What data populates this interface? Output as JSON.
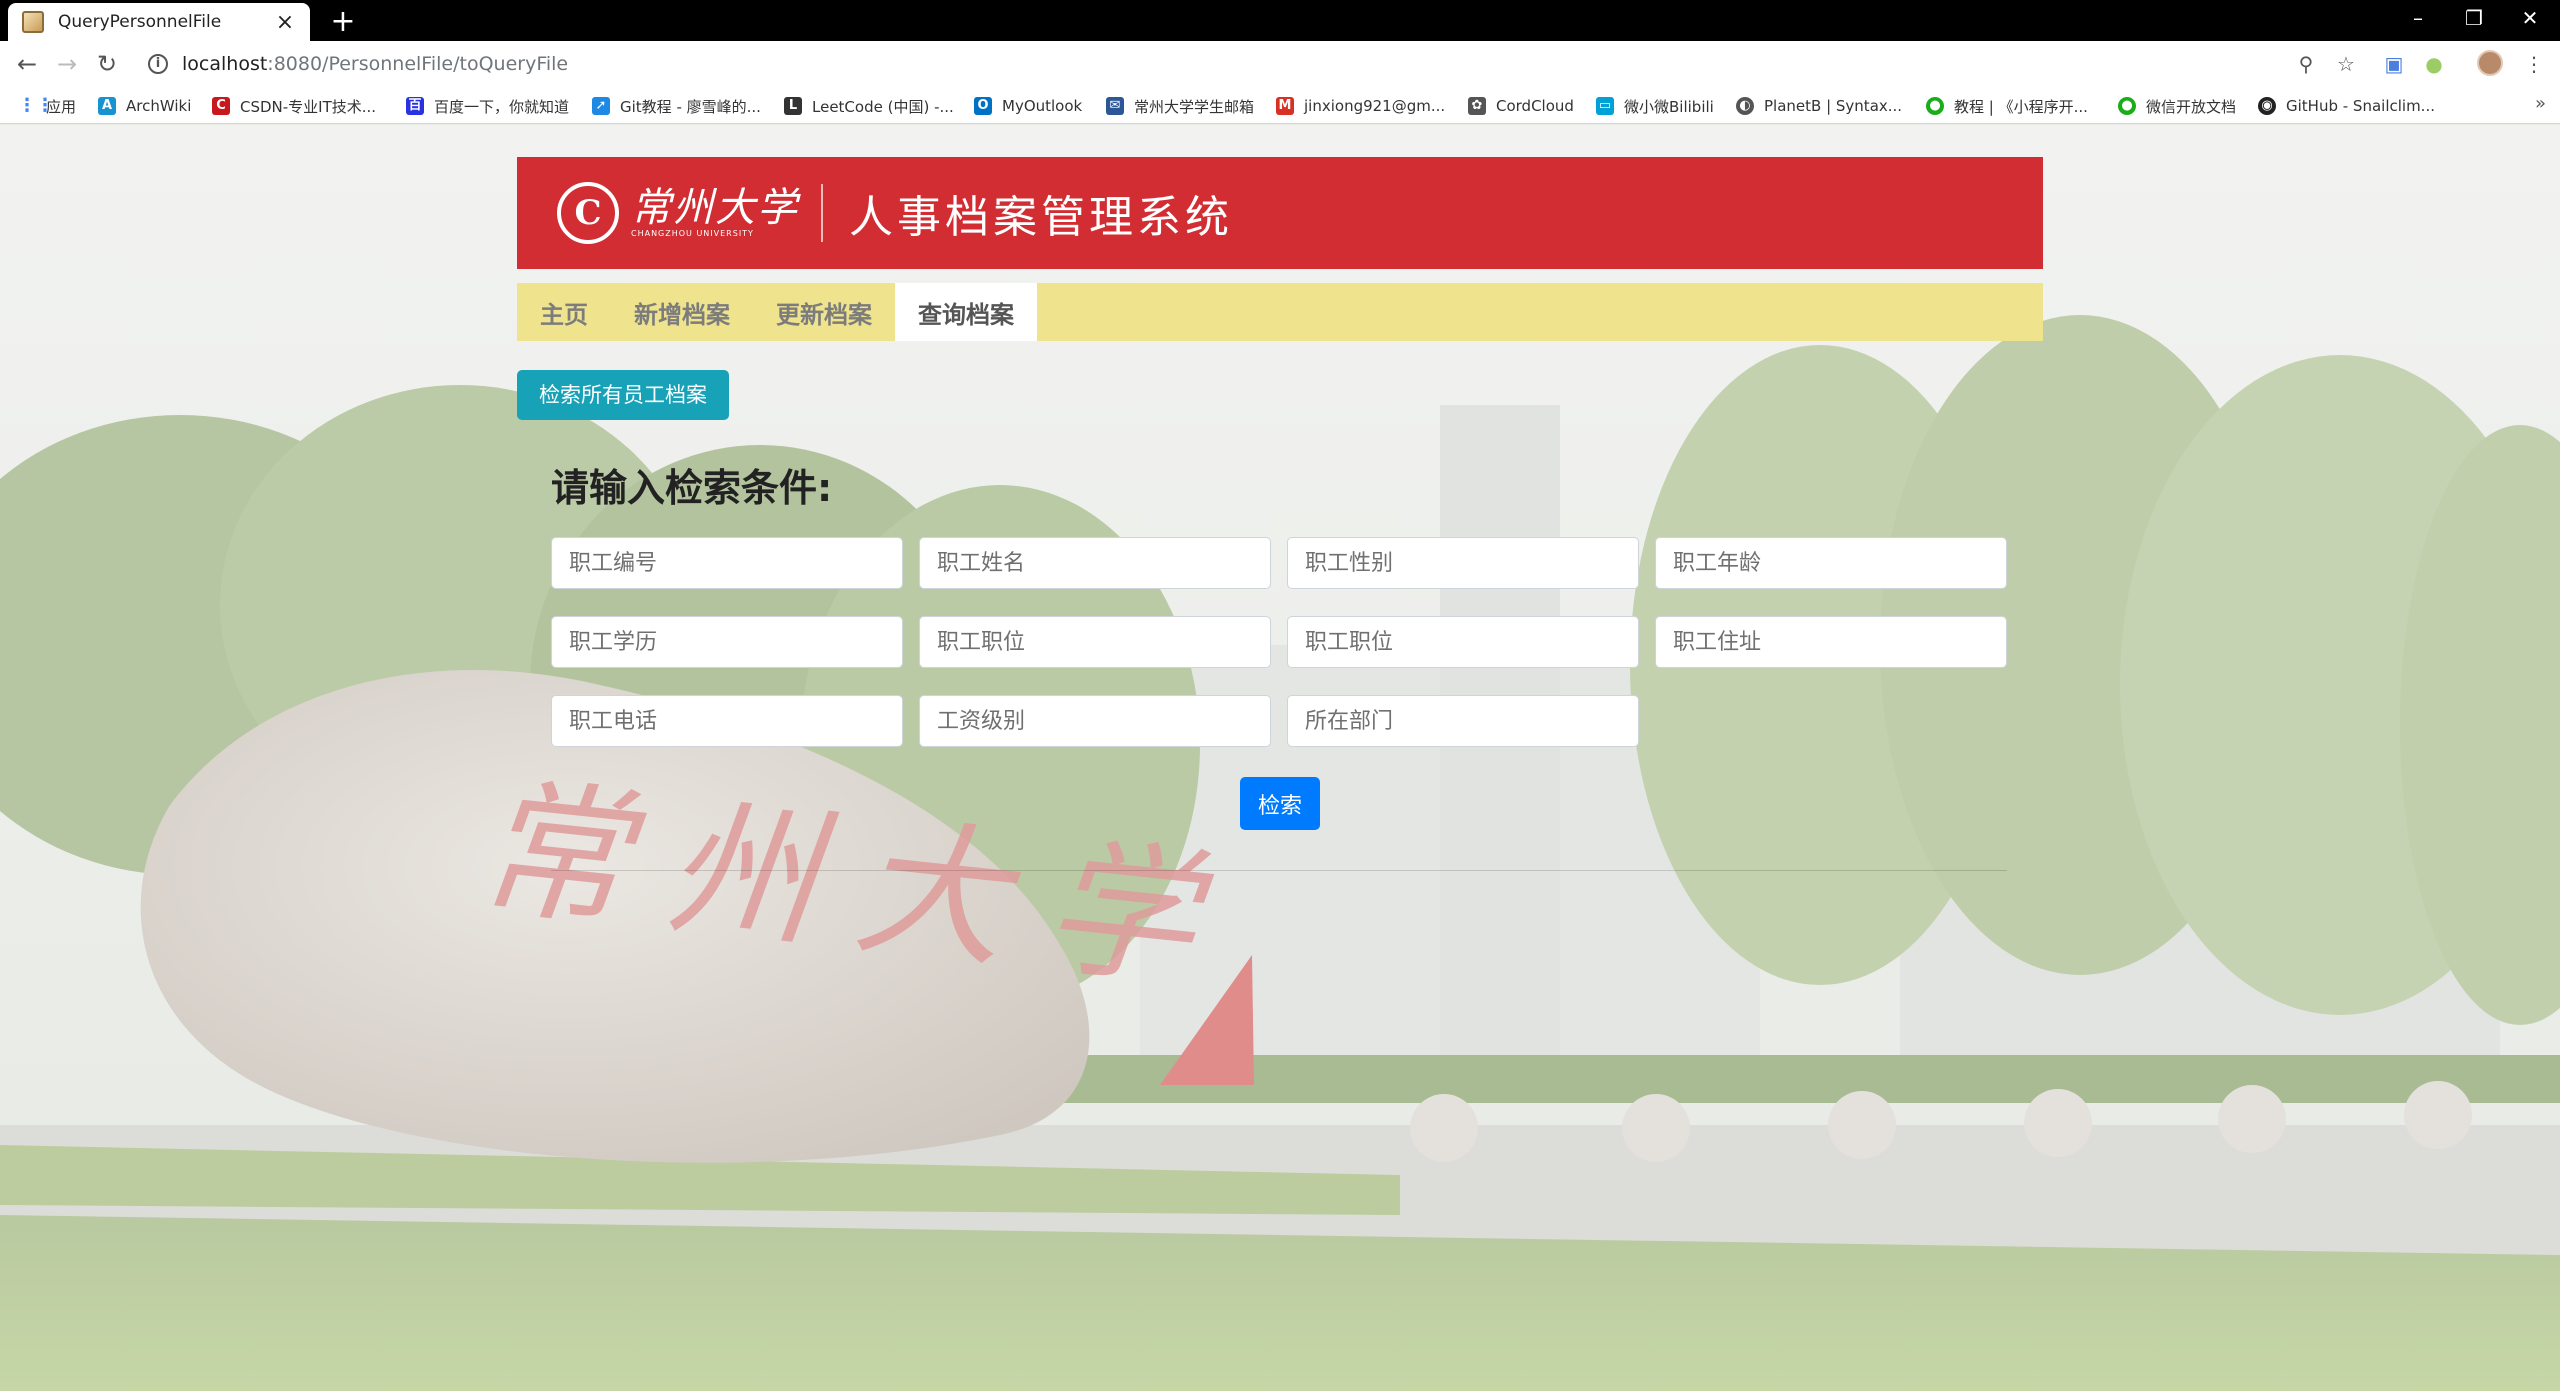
{
  "browser": {
    "tab_title": "QueryPersonnelFile",
    "new_tab": "+",
    "url_host": "localhost",
    "url_path": ":8080/PersonnelFile/toQueryFile",
    "bookmarks": [
      {
        "label": "应用",
        "color": "#4285f4"
      },
      {
        "label": "ArchWiki",
        "color": "#1793d1"
      },
      {
        "label": "CSDN-专业IT技术...",
        "color": "#c9171e"
      },
      {
        "label": "百度一下，你就知道",
        "color": "#2932e1"
      },
      {
        "label": "Git教程 - 廖雪峰的...",
        "color": "#1e88e5"
      },
      {
        "label": "LeetCode (中国) -...",
        "color": "#333333"
      },
      {
        "label": "MyOutlook",
        "color": "#0072c6"
      },
      {
        "label": "常州大学学生邮箱",
        "color": "#2b5797"
      },
      {
        "label": "jinxiong921@gm...",
        "color": "#d93025"
      },
      {
        "label": "CordCloud",
        "color": "#555555"
      },
      {
        "label": "微小微Bilibili",
        "color": "#00a1d6"
      },
      {
        "label": "PlanetB | Syntax...",
        "color": "#555555"
      },
      {
        "label": "教程 | 《小程序开...",
        "color": "#1aad19"
      },
      {
        "label": "微信开放文档",
        "color": "#1aad19"
      },
      {
        "label": "GitHub - Snailclim...",
        "color": "#222222"
      }
    ],
    "more_bookmarks": "»"
  },
  "header": {
    "logo_cn": "常州大学",
    "logo_en": "CHANGZHOU UNIVERSITY",
    "system_title": "人事档案管理系统"
  },
  "nav": {
    "items": [
      {
        "label": "主页"
      },
      {
        "label": "新增档案"
      },
      {
        "label": "更新档案"
      },
      {
        "label": "查询档案",
        "active": true
      }
    ]
  },
  "actions": {
    "query_all_label": "检索所有员工档案",
    "search_label": "检索"
  },
  "form": {
    "title": "请输入检索条件:",
    "fields": [
      {
        "placeholder": "职工编号",
        "value": ""
      },
      {
        "placeholder": "职工姓名",
        "value": ""
      },
      {
        "placeholder": "职工性别",
        "value": ""
      },
      {
        "placeholder": "职工年龄",
        "value": ""
      },
      {
        "placeholder": "职工学历",
        "value": ""
      },
      {
        "placeholder": "职工职位",
        "value": ""
      },
      {
        "placeholder": "职工职位",
        "value": ""
      },
      {
        "placeholder": "职工住址",
        "value": ""
      },
      {
        "placeholder": "职工电话",
        "value": ""
      },
      {
        "placeholder": "工资级别",
        "value": ""
      },
      {
        "placeholder": "所在部门",
        "value": ""
      }
    ]
  },
  "background": {
    "rock_inscription": "常州大学"
  },
  "colors": {
    "banner_red": "#d12d32",
    "nav_yellow": "#efe48d",
    "info_button": "#17a2b8",
    "primary_button": "#007bff"
  }
}
